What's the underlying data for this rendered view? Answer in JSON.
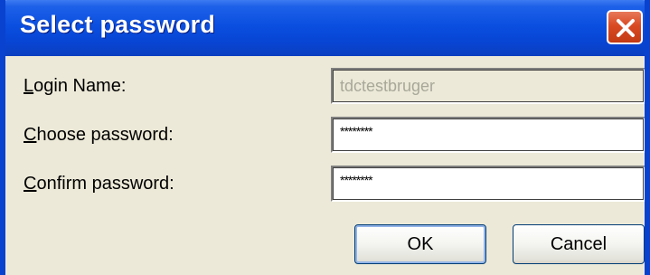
{
  "window": {
    "title": "Select password"
  },
  "form": {
    "login_label_first": "L",
    "login_label_rest": "ogin Name:",
    "login_value": "tdctestbruger",
    "choose_label_first": "C",
    "choose_label_rest": "hoose password:",
    "choose_value": "********",
    "confirm_label_first": "C",
    "confirm_label_rest": "onfirm password:",
    "confirm_value": "********"
  },
  "buttons": {
    "ok_label": "OK",
    "cancel_label": "Cancel"
  },
  "icons": {
    "close": "close-icon"
  },
  "colors": {
    "titlebar": "#0a4fe0",
    "close_button": "#d84a22",
    "window_background": "#ece9d8"
  }
}
